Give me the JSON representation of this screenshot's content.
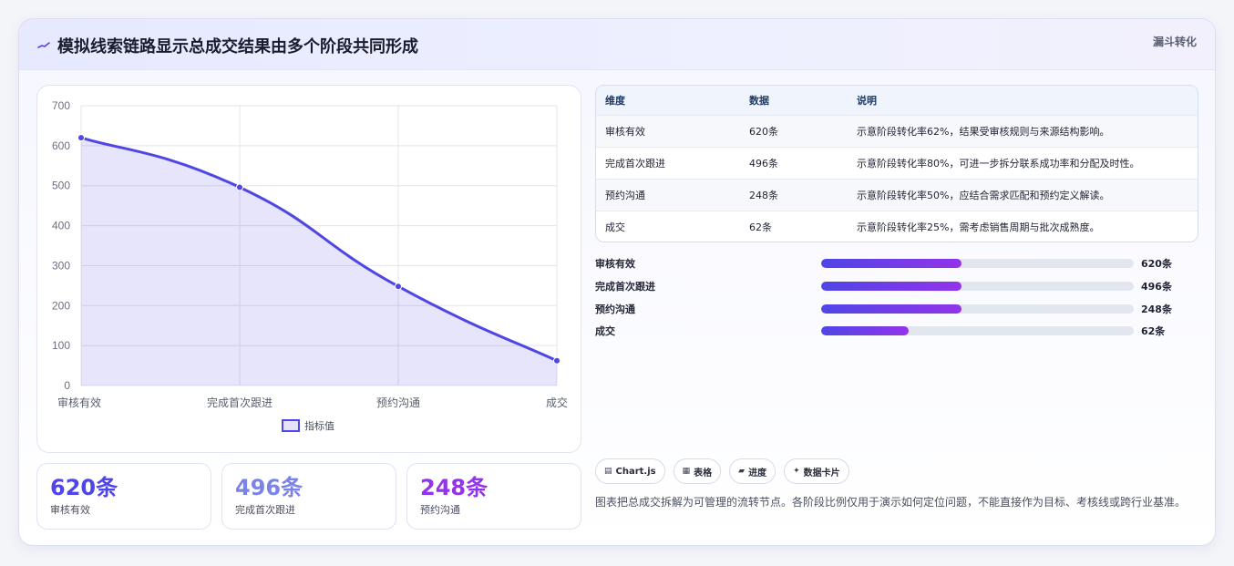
{
  "header": {
    "icon": "sparkline-icon",
    "title": "模拟线索链路显示总成交结果由多个阶段共同形成",
    "tag": "漏斗转化"
  },
  "chart_data": {
    "type": "line",
    "categories": [
      "审核有效",
      "完成首次跟进",
      "预约沟通",
      "成交"
    ],
    "series": [
      {
        "name": "指标值",
        "values": [
          620,
          496,
          248,
          62
        ]
      }
    ],
    "ylim": [
      0,
      700
    ],
    "yticks": [
      "0",
      "100",
      "200",
      "300",
      "400",
      "500",
      "600",
      "700"
    ],
    "grid": true,
    "legend": "bottom",
    "fill": true,
    "line_color": "#4f46e5"
  },
  "kpis": [
    {
      "value": "620条",
      "label": "审核有效",
      "color": "#4f46e5"
    },
    {
      "value": "496条",
      "label": "完成首次跟进",
      "color": "#7c83e8"
    },
    {
      "value": "248条",
      "label": "预约沟通",
      "color": "#9333ea"
    }
  ],
  "table": {
    "headers": [
      "维度",
      "数据",
      "说明"
    ],
    "rows": [
      [
        "审核有效",
        "620条",
        "示意阶段转化率62%，结果受审核规则与来源结构影响。"
      ],
      [
        "完成首次跟进",
        "496条",
        "示意阶段转化率80%，可进一步拆分联系成功率和分配及时性。"
      ],
      [
        "预约沟通",
        "248条",
        "示意阶段转化率50%，应结合需求匹配和预约定义解读。"
      ],
      [
        "成交",
        "62条",
        "示意阶段转化率25%，需考虑销售周期与批次成熟度。"
      ]
    ]
  },
  "progress": [
    {
      "label": "审核有效",
      "value": "620条",
      "fill_fraction": 0.45
    },
    {
      "label": "完成首次跟进",
      "value": "496条",
      "fill_fraction": 0.45
    },
    {
      "label": "预约沟通",
      "value": "248条",
      "fill_fraction": 0.45
    },
    {
      "label": "成交",
      "value": "62条",
      "fill_fraction": 0.28
    }
  ],
  "chips": [
    {
      "icon": "chart-icon",
      "glyph": "▤",
      "label": "Chart.js"
    },
    {
      "icon": "table-icon",
      "glyph": "▦",
      "label": "表格"
    },
    {
      "icon": "progress-icon",
      "glyph": "▰",
      "label": "进度"
    },
    {
      "icon": "sparkle-icon",
      "glyph": "✦",
      "label": "数据卡片"
    }
  ],
  "description": "图表把总成交拆解为可管理的流转节点。各阶段比例仅用于演示如何定位问题，不能直接作为目标、考核线或跨行业基准。"
}
